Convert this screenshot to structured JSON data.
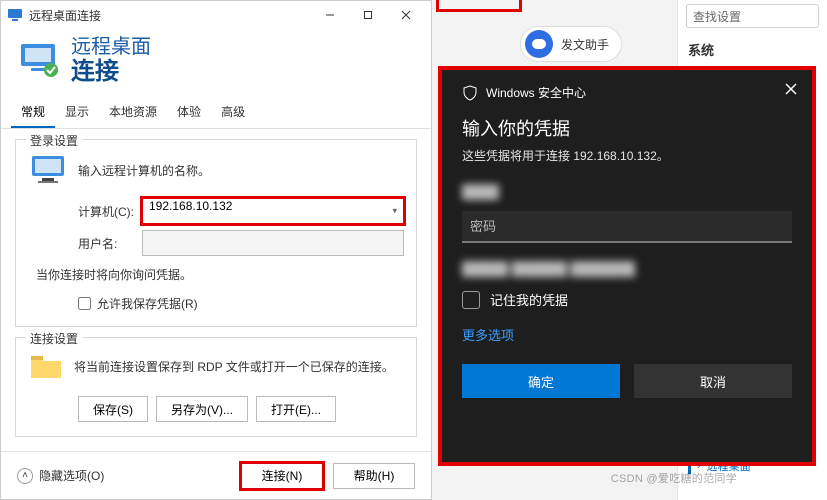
{
  "rdc": {
    "title": "远程桌面连接",
    "header_line1": "远程桌面",
    "header_line2": "连接",
    "tabs": [
      "常规",
      "显示",
      "本地资源",
      "体验",
      "高级"
    ],
    "login": {
      "group_title": "登录设置",
      "prompt": "输入远程计算机的名称。",
      "computer_label": "计算机(C):",
      "computer_value": "192.168.10.132",
      "user_label": "用户名:",
      "user_value": "",
      "note": "当你连接时将向你询问凭据。",
      "save_creds": "允许我保存凭据(R)"
    },
    "conn": {
      "group_title": "连接设置",
      "desc": "将当前连接设置保存到 RDP 文件或打开一个已保存的连接。",
      "save": "保存(S)",
      "save_as": "另存为(V)...",
      "open": "打开(E)..."
    },
    "footer": {
      "hide": "隐藏选项(O)",
      "connect": "连接(N)",
      "help": "帮助(H)"
    }
  },
  "security": {
    "title": "Windows 安全中心",
    "heading": "输入你的凭据",
    "sub": "这些凭据将用于连接 192.168.10.132。",
    "password_placeholder": "密码",
    "remember": "记住我的凭据",
    "more": "更多选项",
    "ok": "确定",
    "cancel": "取消"
  },
  "settings": {
    "search_placeholder": "查找设置",
    "system": "系统",
    "remote_desktop": "远程桌面"
  },
  "assistant": {
    "label": "发文助手"
  },
  "watermark": "CSDN @爱吃糖的范同学"
}
